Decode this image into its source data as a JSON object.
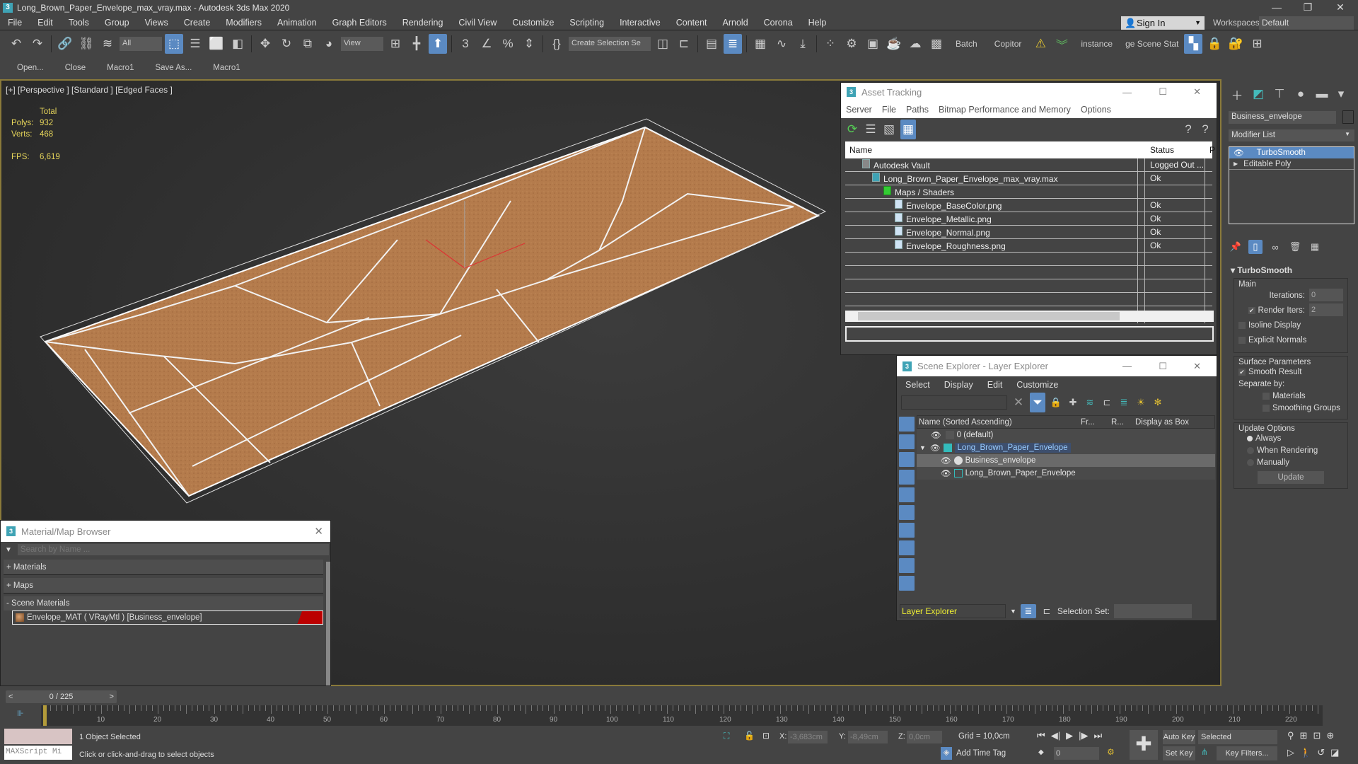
{
  "window": {
    "title": "Long_Brown_Paper_Envelope_max_vray.max - Autodesk 3ds Max 2020",
    "app_icon": "3"
  },
  "menu": [
    "File",
    "Edit",
    "Tools",
    "Group",
    "Views",
    "Create",
    "Modifiers",
    "Animation",
    "Graph Editors",
    "Rendering",
    "Civil View",
    "Customize",
    "Scripting",
    "Interactive",
    "Content",
    "Arnold",
    "Corona",
    "Help"
  ],
  "account": {
    "sign_in": "Sign In",
    "workspaces_label": "Workspaces:",
    "workspace": "Default"
  },
  "toolbar": {
    "filter": "All",
    "ref_coord": "View",
    "selection_set": "Create Selection Se",
    "batch": "Batch",
    "copitor": "Copitor",
    "instance": "instance",
    "scene_states": "ge Scene Stat"
  },
  "toolbar2": [
    "Open...",
    "Close",
    "Macro1",
    "Save As...",
    "Macro1"
  ],
  "viewport": {
    "label": "[+] [Perspective ] [Standard ] [Edged Faces ]",
    "total_label": "Total",
    "polys_label": "Polys:",
    "polys": "932",
    "verts_label": "Verts:",
    "verts": "468",
    "fps_label": "FPS:",
    "fps": "6,619"
  },
  "asset_tracking": {
    "title": "Asset Tracking",
    "menu": [
      "Server",
      "File",
      "Paths",
      "Bitmap Performance and Memory",
      "Options"
    ],
    "columns": [
      "Name",
      "Status",
      "P"
    ],
    "rows": [
      {
        "name": "Autodesk Vault",
        "status": "Logged Out ..."
      },
      {
        "name": "Long_Brown_Paper_Envelope_max_vray.max",
        "status": "Ok"
      },
      {
        "name": "Maps / Shaders",
        "status": ""
      },
      {
        "name": "Envelope_BaseColor.png",
        "status": "Ok"
      },
      {
        "name": "Envelope_Metallic.png",
        "status": "Ok"
      },
      {
        "name": "Envelope_Normal.png",
        "status": "Ok"
      },
      {
        "name": "Envelope_Roughness.png",
        "status": "Ok"
      }
    ]
  },
  "scene_explorer": {
    "title": "Scene Explorer - Layer Explorer",
    "menu": [
      "Select",
      "Display",
      "Edit",
      "Customize"
    ],
    "columns": [
      "Name (Sorted Ascending)",
      "Fr...",
      "R...",
      "Display as Box"
    ],
    "rows": [
      {
        "name": "0 (default)"
      },
      {
        "name": "Long_Brown_Paper_Envelope"
      },
      {
        "name": "Business_envelope"
      },
      {
        "name": "Long_Brown_Paper_Envelope"
      }
    ],
    "explorer_select": "Layer Explorer",
    "selection_set_label": "Selection Set:"
  },
  "command_panel": {
    "object_name": "Business_envelope",
    "modifier_list": "Modifier List",
    "stack": [
      "TurboSmooth",
      "Editable Poly"
    ],
    "rollout_title": "TurboSmooth",
    "main_label": "Main",
    "iterations_label": "Iterations:",
    "iterations": "0",
    "render_iters_label": "Render Iters:",
    "render_iters": "2",
    "isoline": "Isoline Display",
    "explicit_normals": "Explicit Normals",
    "surface_label": "Surface Parameters",
    "smooth_result": "Smooth Result",
    "separate_by": "Separate by:",
    "materials": "Materials",
    "smoothing_groups": "Smoothing Groups",
    "update_options": "Update Options",
    "always": "Always",
    "when_rendering": "When Rendering",
    "manually": "Manually",
    "update_button": "Update"
  },
  "material_browser": {
    "title": "Material/Map Browser",
    "search_placeholder": "Search by Name ...",
    "groups": [
      "+ Materials",
      "+ Maps",
      "- Scene Materials"
    ],
    "material": "Envelope_MAT  ( VRayMtl )  [Business_envelope]"
  },
  "timeline": {
    "frame": "0 / 225",
    "ticks": [
      10,
      20,
      30,
      40,
      50,
      60,
      70,
      80,
      90,
      100,
      110,
      120,
      130,
      140,
      150,
      160,
      170,
      180,
      190,
      200,
      210,
      220
    ],
    "max": 225
  },
  "status": {
    "maxscript": "MAXScript Mi",
    "selected": "1 Object Selected",
    "hint": "Click or click-and-drag to select objects",
    "x_label": "X:",
    "x": "-3,683cm",
    "y_label": "Y:",
    "y": "-8,49cm",
    "z_label": "Z:",
    "z": "0,0cm",
    "grid": "Grid = 10,0cm",
    "add_time_tag": "Add Time Tag",
    "auto_key": "Auto Key",
    "set_key": "Set Key",
    "key_mode": "Selected",
    "key_filters": "Key Filters...",
    "current_frame": "0"
  }
}
